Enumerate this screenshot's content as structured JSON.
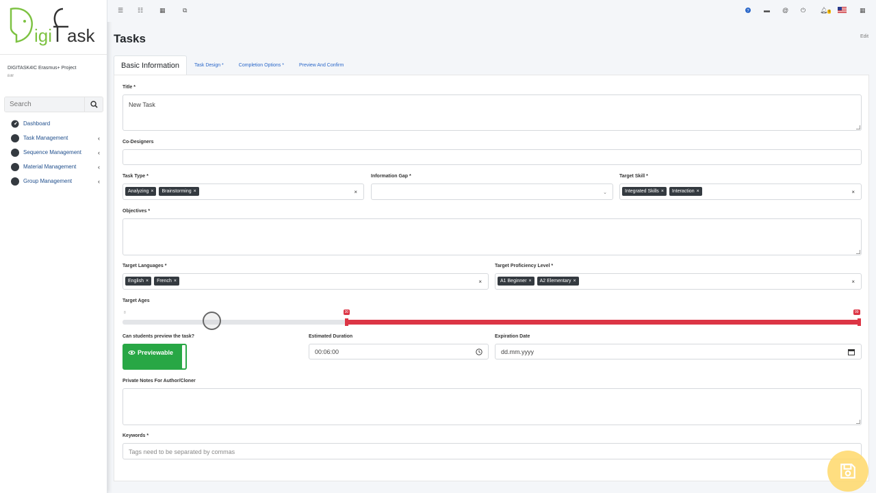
{
  "sidebar": {
    "logo_alt": "DigiTask",
    "project_name": "DIGITASK4IC Erasmus+ Project",
    "project_edit": "Edit",
    "search_placeholder": "Search",
    "items": [
      {
        "label": "Dashboard",
        "icon": "dashboard-icon",
        "has_children": false
      },
      {
        "label": "Task Management",
        "icon": "circle-icon",
        "has_children": true
      },
      {
        "label": "Sequence Management",
        "icon": "circle-icon",
        "has_children": true
      },
      {
        "label": "Material Management",
        "icon": "circle-icon",
        "has_children": true
      },
      {
        "label": "Group Management",
        "icon": "circle-icon",
        "has_children": true
      }
    ]
  },
  "topbar": {
    "left_icons": [
      "menu-icon",
      "list-icon",
      "calendar-icon",
      "copy-icon"
    ],
    "right_icons": [
      "help-icon",
      "trash-icon",
      "at-icon",
      "power-icon",
      "bell-icon",
      "flag-us-icon",
      "grid-icon"
    ],
    "notification_count": "0"
  },
  "header": {
    "title": "Tasks",
    "edit_label": "Edit"
  },
  "tabs": [
    {
      "label": "Basic Information",
      "active": true
    },
    {
      "label": "Task Design *",
      "active": false
    },
    {
      "label": "Completion Options *",
      "active": false
    },
    {
      "label": "Preview And Confirm",
      "active": false
    }
  ],
  "form": {
    "title": {
      "label": "Title *",
      "value": "New Task"
    },
    "co_designers": {
      "label": "Co-Designers",
      "value": ""
    },
    "task_type": {
      "label": "Task Type *",
      "tags": [
        "Analyzing",
        "Brainstorming"
      ]
    },
    "information_gap": {
      "label": "Information Gap *",
      "value": ""
    },
    "target_skill": {
      "label": "Target Skill *",
      "tags": [
        "Integrated Skills",
        "Interaction"
      ]
    },
    "objectives": {
      "label": "Objectives *",
      "value": ""
    },
    "target_languages": {
      "label": "Target Languages *",
      "tags": [
        "English",
        "French"
      ]
    },
    "target_proficiency": {
      "label": "Target Proficiency Level *",
      "tags": [
        "A1 Beginner",
        "A2 Elementary"
      ]
    },
    "target_ages": {
      "label": "Target Ages",
      "min": "8",
      "low": "30",
      "high": "99",
      "range_max": 99
    },
    "preview": {
      "label": "Can students preview the task?",
      "button": "Previewable"
    },
    "estimated_duration": {
      "label": "Estimated Duration",
      "value": "00:06:00"
    },
    "expiration_date": {
      "label": "Expiration Date",
      "placeholder": "dd.mm.yyyy"
    },
    "private_notes": {
      "label": "Private Notes For Author/Cloner",
      "value": ""
    },
    "keywords": {
      "label": "Keywords *",
      "placeholder": "Tags need to be separated by commas"
    }
  },
  "colors": {
    "accent": "#dc3545",
    "success": "#28a745",
    "link": "#2a67c9",
    "tag": "#343a40",
    "fab": "#ffd96a"
  }
}
